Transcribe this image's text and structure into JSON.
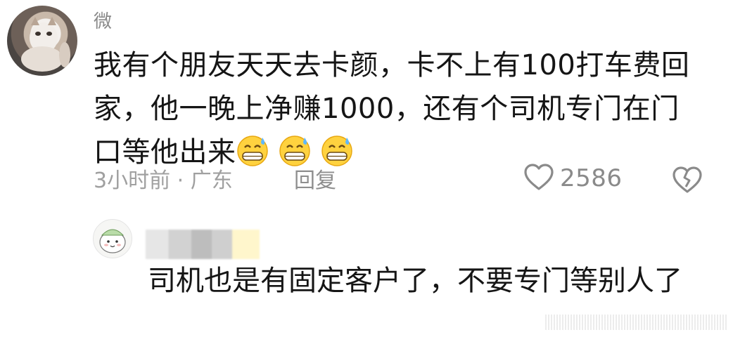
{
  "comment": {
    "username": "微",
    "text": "我有个朋友天天去卡颜，卡不上有100打车费回家，他一晚上净赚1000，还有个司机专门在门口等他出来",
    "emoji_count": 3,
    "emoji_icon": "grinning-sweat-emoji",
    "meta": "3小时前 · 广东",
    "reply_label": "回复",
    "like_count": "2586"
  },
  "reply": {
    "text": "司机也是有固定客户了，不要专门等别人了"
  },
  "colors": {
    "text": "#151515",
    "meta": "#a0a0a0",
    "icon": "#8a8a8a"
  }
}
